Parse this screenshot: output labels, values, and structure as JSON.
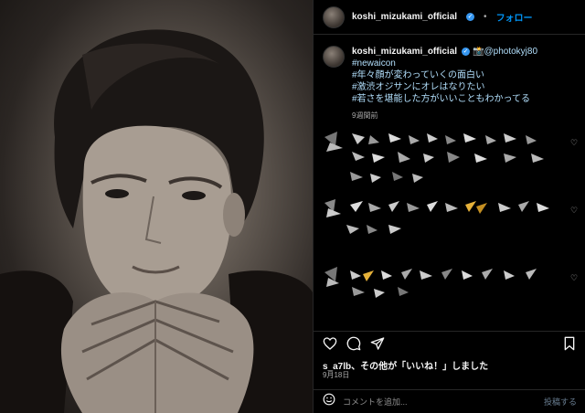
{
  "header": {
    "username": "koshi_mizukami_official",
    "follow_label": "フォロー"
  },
  "caption": {
    "username": "koshi_mizukami_official",
    "mention": "📸@photokyj80",
    "hashtags": [
      "#newaicon",
      "#年々顔が変わっていくの面白い",
      "#激渋オジサンにオレはなりたい",
      "#若さを堪能した方がいいこともわかってる"
    ],
    "time_ago": "9週間前"
  },
  "likes": {
    "text": "s_a7lb、その他が「いいね！」しました"
  },
  "date": "9月18日",
  "add_comment": {
    "placeholder": "コメントを追加...",
    "post_label": "投稿する"
  },
  "colors": {
    "accent": "#0095f6",
    "background": "#000000",
    "hashtag": "#b2dffc",
    "verified": "#3797f0"
  },
  "icons": {
    "like": "heart-icon",
    "comment": "comment-icon",
    "share": "paper-plane-icon",
    "save": "bookmark-icon",
    "emoji": "smiley-icon"
  }
}
